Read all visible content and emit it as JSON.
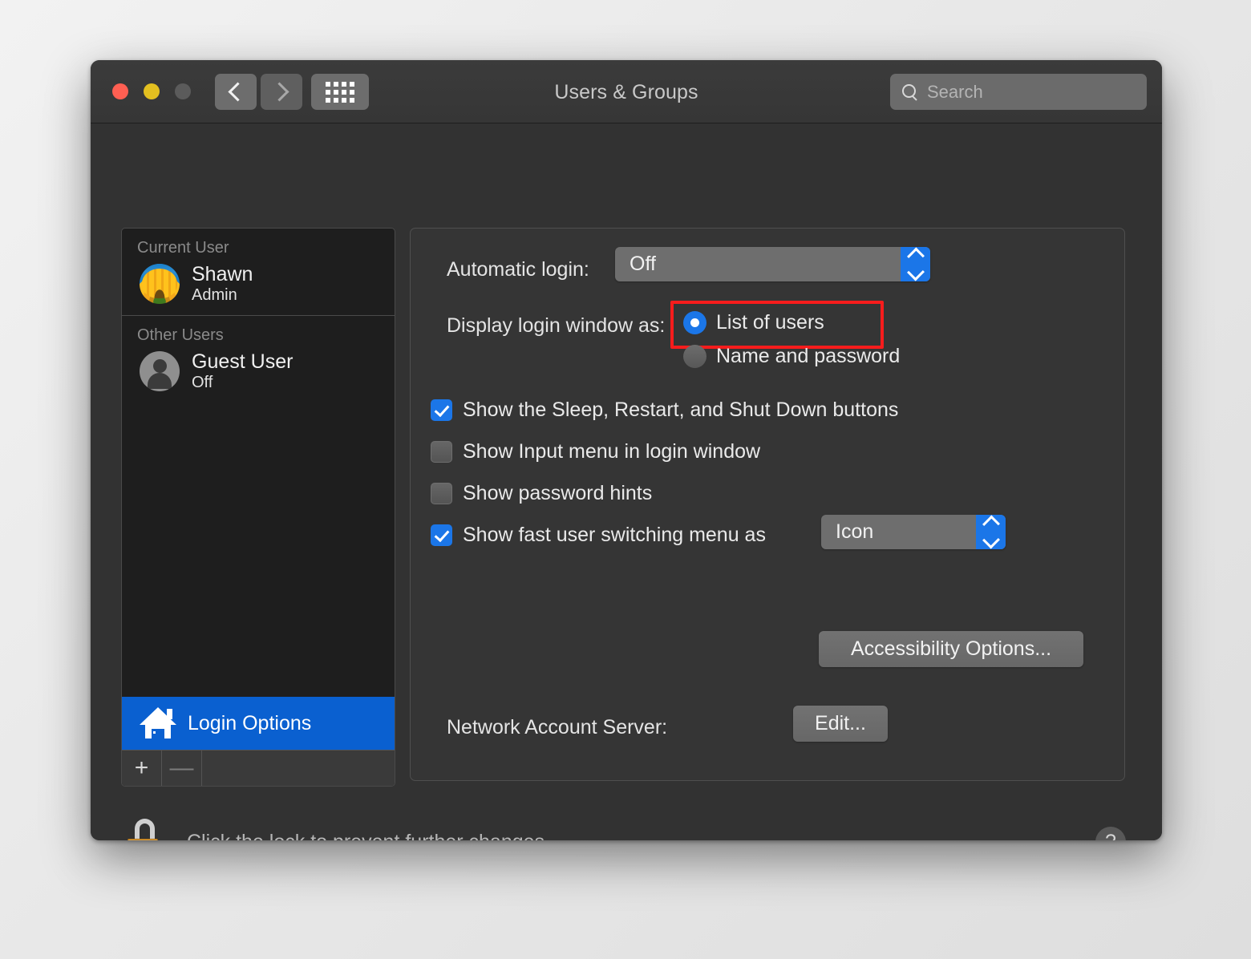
{
  "window": {
    "title": "Users & Groups",
    "traffic_lights": [
      "close-button",
      "minimize-button",
      "zoom-button"
    ],
    "back_icon": "chevron-left-icon",
    "forward_icon": "chevron-right-icon",
    "grid_icon": "grid-icon"
  },
  "search": {
    "placeholder": "Search",
    "value": "",
    "icon": "search-icon"
  },
  "sidebar": {
    "groups": [
      {
        "header": "Current User",
        "users": [
          {
            "name": "Shawn",
            "role": "Admin",
            "avatar": "sunflower-avatar"
          }
        ]
      },
      {
        "header": "Other Users",
        "users": [
          {
            "name": "Guest User",
            "role": "Off",
            "avatar": "person-avatar"
          }
        ]
      }
    ],
    "login_options": {
      "label": "Login Options",
      "icon": "house-icon",
      "selected": true,
      "accent": "#0a60d0"
    },
    "footer": {
      "add_label": "+",
      "remove_label": "—"
    }
  },
  "main": {
    "automatic_login": {
      "label": "Automatic login:",
      "value": "Off",
      "options": [
        "Off"
      ]
    },
    "display_login_window": {
      "label": "Display login window as:",
      "options": [
        {
          "label": "List of users",
          "selected": true
        },
        {
          "label": "Name and password",
          "selected": false
        }
      ],
      "highlight_color": "#f71c1c"
    },
    "checkboxes": [
      {
        "label": "Show the Sleep, Restart, and Shut Down buttons",
        "checked": true
      },
      {
        "label": "Show Input menu in login window",
        "checked": false
      },
      {
        "label": "Show password hints",
        "checked": false
      },
      {
        "label": "Show fast user switching menu as",
        "checked": true
      }
    ],
    "fast_user_switching": {
      "value": "Icon",
      "options": [
        "Icon"
      ]
    },
    "accessibility_button": "Accessibility Options...",
    "network_account_server": {
      "label": "Network Account Server:",
      "button": "Edit..."
    }
  },
  "footer": {
    "lock_text": "Click the lock to prevent further changes.",
    "lock_icon": "unlocked-padlock-icon",
    "help_label": "?"
  },
  "colors": {
    "accent_blue": "#1b76e8",
    "selection_blue": "#0a60d0",
    "highlight_red": "#f71c1c",
    "window_bg": "#323232",
    "sidebar_bg": "#1e1e1e"
  }
}
